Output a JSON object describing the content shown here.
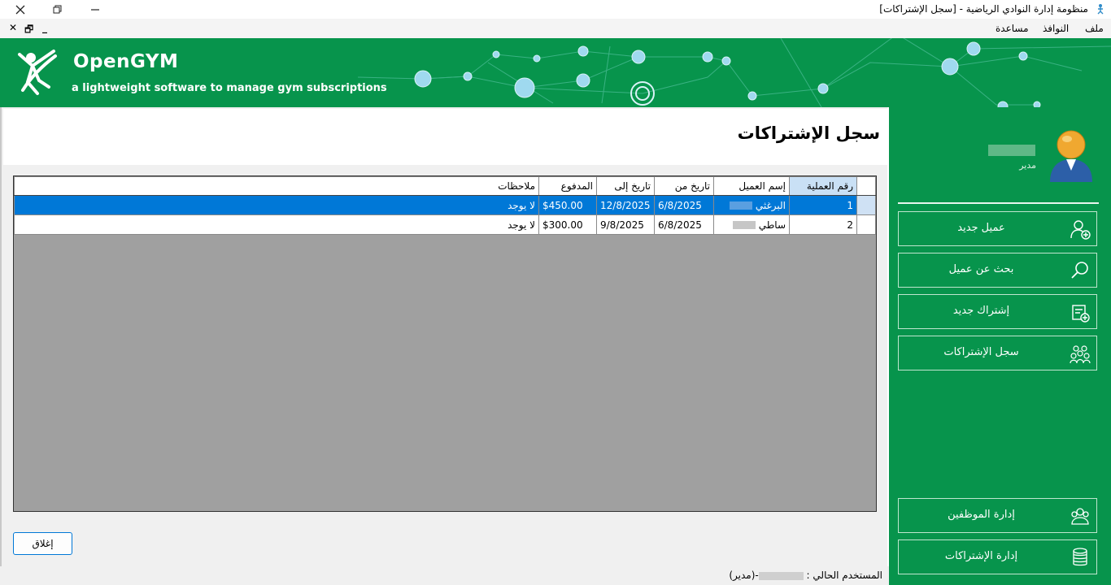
{
  "window": {
    "title": "منظومة إدارة النوادي الرياضية - [سجل الإشتراكات]"
  },
  "menu": {
    "items": [
      "ملف",
      "النوافذ",
      "مساعدة"
    ]
  },
  "brand": {
    "name": "OpenGYM",
    "tagline": "a lightweight software to manage gym subscriptions"
  },
  "user": {
    "role": "مدير"
  },
  "sidebar": {
    "buttons": [
      {
        "label": "عميل جديد",
        "icon": "add-user-icon"
      },
      {
        "label": "بحث عن عميل",
        "icon": "search-icon"
      },
      {
        "label": "إشتراك جديد",
        "icon": "add-subscription-icon"
      },
      {
        "label": "سجل الإشتراكات",
        "icon": "group-icon"
      },
      {
        "label": "إدارة الموظفين",
        "icon": "staff-icon"
      },
      {
        "label": "إدارة الإشتراكات",
        "icon": "coins-icon"
      }
    ]
  },
  "form": {
    "title": "سجل الإشتراكات",
    "close_label": "إغلاق"
  },
  "table": {
    "columns": [
      "رقم العملية",
      "إسم العميل",
      "تاريخ من",
      "تاريخ إلى",
      "المدفوع",
      "ملاحظات"
    ],
    "rows": [
      {
        "id": "1",
        "client": "البرغثي",
        "from": "6/8/2025",
        "to": "12/8/2025",
        "paid": "$450.00",
        "notes": "لا يوجد"
      },
      {
        "id": "2",
        "client": "ساطي",
        "from": "6/8/2025",
        "to": "9/8/2025",
        "paid": "$300.00",
        "notes": "لا يوجد"
      }
    ]
  },
  "status": {
    "prefix": "المستخدم الحالي :",
    "suffix": "-(مدير)"
  },
  "colors": {
    "brand_green": "#07944c",
    "selection_blue": "#0078d7",
    "grid_gray": "#a0a0a0"
  }
}
